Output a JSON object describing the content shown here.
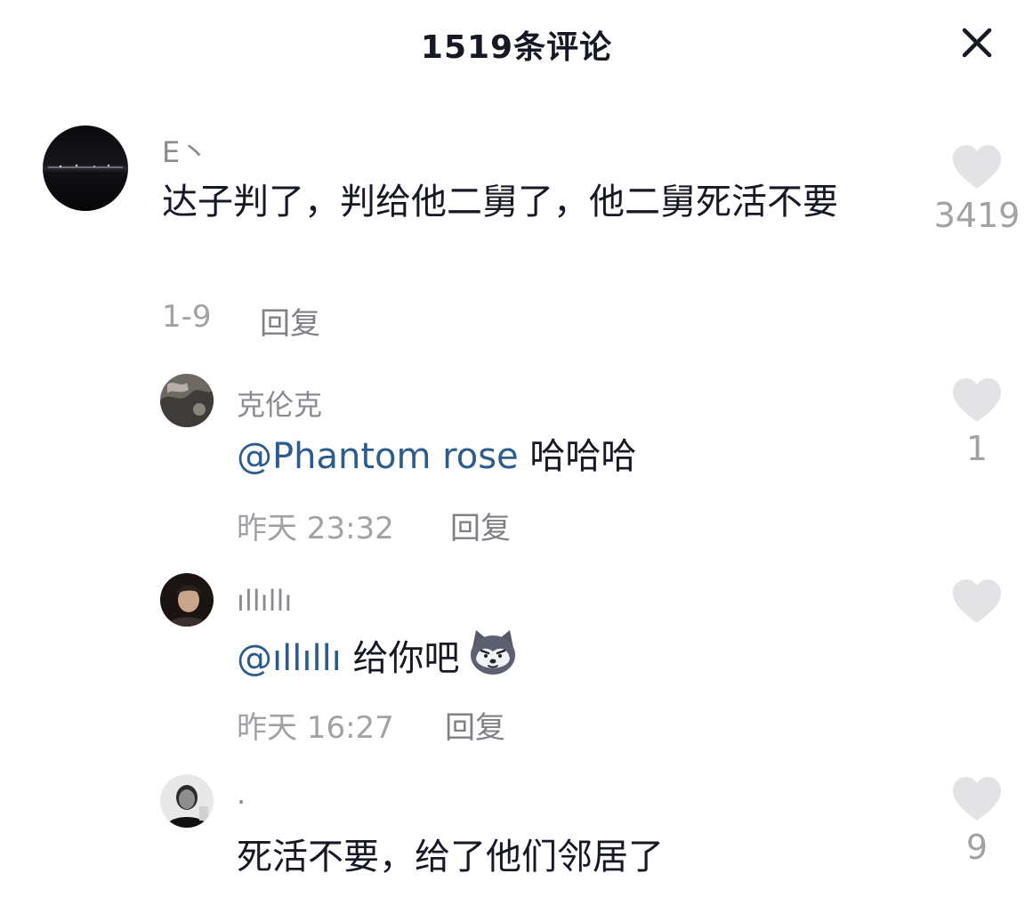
{
  "header": {
    "title": "1519条评论",
    "close_icon": "close-icon"
  },
  "comments": [
    {
      "username": "E丶",
      "text": "达子判了，判给他二舅了，他二舅死活不要",
      "date": "1-9",
      "reply_label": "回复",
      "likes": "3419"
    },
    {
      "username": "克伦克",
      "mention": "@Phantom rose",
      "text": "哈哈哈",
      "date": "昨天 23:32",
      "reply_label": "回复",
      "likes": "1"
    },
    {
      "username": "ıllıllı",
      "mention": "@ıllıllı",
      "text": "给你吧",
      "emoji": "husky-dog-emoji",
      "date": "昨天 16:27",
      "reply_label": "回复",
      "likes": ""
    },
    {
      "username": "·",
      "text": "死活不要，给了他们邻居了",
      "likes": "9"
    }
  ],
  "colors": {
    "text": "#161823",
    "secondary": "#8a8b91",
    "mention": "#2c5c8e",
    "heart": "#e3e3e5"
  }
}
